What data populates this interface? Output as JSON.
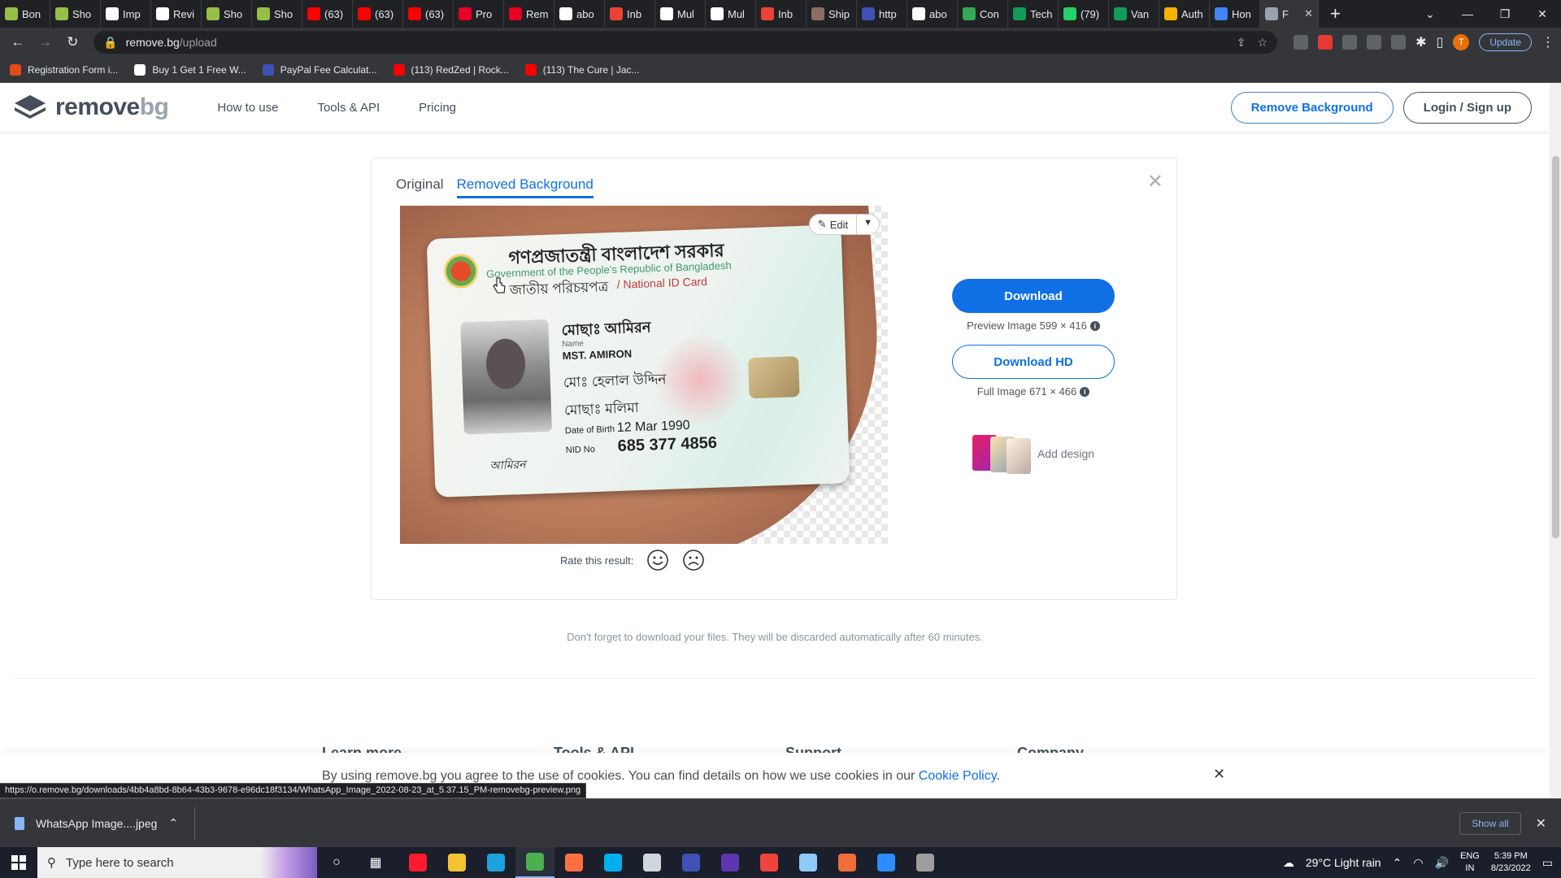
{
  "browser": {
    "tabs": [
      {
        "label": "Bon",
        "color": "#96bf48"
      },
      {
        "label": "Sho",
        "color": "#96bf48"
      },
      {
        "label": "Imp",
        "color": "#ffffff"
      },
      {
        "label": "Revi",
        "color": "#ffffff"
      },
      {
        "label": "Sho",
        "color": "#96bf48"
      },
      {
        "label": "Sho",
        "color": "#96bf48"
      },
      {
        "label": "(63)",
        "color": "#ff0000"
      },
      {
        "label": "(63)",
        "color": "#ff0000"
      },
      {
        "label": "(63)",
        "color": "#ff0000"
      },
      {
        "label": "Pro",
        "color": "#e60023"
      },
      {
        "label": "Rem",
        "color": "#e60023"
      },
      {
        "label": "abo",
        "color": "#ffffff"
      },
      {
        "label": "Inb",
        "color": "#ea4335"
      },
      {
        "label": "Mul",
        "color": "#ffffff"
      },
      {
        "label": "Mul",
        "color": "#ffffff"
      },
      {
        "label": "Inb",
        "color": "#ea4335"
      },
      {
        "label": "Ship",
        "color": "#8d6e63"
      },
      {
        "label": "http",
        "color": "#3f51b5"
      },
      {
        "label": "abo",
        "color": "#ffffff"
      },
      {
        "label": "Con",
        "color": "#34a853"
      },
      {
        "label": "Tech",
        "color": "#0f9d58"
      },
      {
        "label": "(79)",
        "color": "#25d366"
      },
      {
        "label": "Van",
        "color": "#0f9d58"
      },
      {
        "label": "Auth",
        "color": "#f4b400"
      },
      {
        "label": "Hon",
        "color": "#4285f4"
      }
    ],
    "active_tab_label": "F",
    "url_host": "remove.bg",
    "url_path": "/upload",
    "update_label": "Update",
    "profile_initial": "T",
    "bookmarks": [
      {
        "label": "Registration Form i...",
        "color": "#e64a19"
      },
      {
        "label": "Buy 1 Get 1 Free W...",
        "color": "#ffffff"
      },
      {
        "label": "PayPal Fee Calculat...",
        "color": "#3f51b5"
      },
      {
        "label": "(113) RedZed | Rock...",
        "color": "#ff0000"
      },
      {
        "label": "(113) The Cure | Jac...",
        "color": "#ff0000"
      }
    ]
  },
  "site": {
    "logo_main": "remove",
    "logo_accent": "bg",
    "nav": [
      "How to use",
      "Tools & API",
      "Pricing"
    ],
    "header_buttons": {
      "remove_bg": "Remove Background",
      "login": "Login / Sign up"
    },
    "brand_color": "#0f70e6"
  },
  "result": {
    "tabs": [
      "Original",
      "Removed Background"
    ],
    "active_tab": "Removed Background",
    "edit_label": "Edit",
    "rate_label": "Rate this result:",
    "download_label": "Download",
    "preview_note": "Preview Image 599 × 416",
    "download_hd_label": "Download HD",
    "full_note": "Full Image 671 × 466",
    "add_design_label": "Add design"
  },
  "id_card": {
    "title_bn": "গণপ্রজাতন্ত্রী বাংলাদেশ সরকার",
    "gov_en": "Government of the People's Republic of Bangladesh",
    "nid_bn": "জাতীয় পরিচয়পত্র",
    "nid_en": "/ National ID Card",
    "name_bn": "মোছাঃ আমিরন",
    "name_label": "Name",
    "name_en": "MST. AMIRON",
    "father_bn": "মোঃ হেলাল উদ্দিন",
    "mother_bn": "মোছাঃ মলিমা",
    "dob_label": "Date of Birth",
    "dob": "12 Mar 1990",
    "nid_label": "NID No",
    "nid": "685 377 4856",
    "signature": "আমিরন"
  },
  "reminder": "Don't forget to download your files. They will be discarded automatically after 60 minutes.",
  "footer_heads": [
    "Learn more",
    "Tools & API",
    "Support",
    "Company"
  ],
  "cookie": {
    "text": "By using remove.bg you agree to the use of cookies. You can find details on how we use cookies in our ",
    "link": "Cookie Policy",
    "tail": "."
  },
  "status_url": "https://o.remove.bg/downloads/4bb4a8bd-8b64-43b3-9678-e96dc18f3134/WhatsApp_Image_2022-08-23_at_5.37.15_PM-removebg-preview.png",
  "download_shelf": {
    "file_name": "WhatsApp Image....jpeg",
    "show_all": "Show all"
  },
  "taskbar": {
    "search_placeholder": "Type here to search",
    "apps": [
      {
        "name": "opera",
        "color": "#ff1b2d"
      },
      {
        "name": "file-explorer",
        "color": "#f4c430"
      },
      {
        "name": "edge",
        "color": "#1fa0e0"
      },
      {
        "name": "chrome",
        "color": "#4caf50"
      },
      {
        "name": "chrome-2",
        "color": "#ff7043"
      },
      {
        "name": "skype",
        "color": "#00aff0"
      },
      {
        "name": "settings",
        "color": "#cfd8dc"
      },
      {
        "name": "app-blue",
        "color": "#3f51b5"
      },
      {
        "name": "app-purple",
        "color": "#5e35b1"
      },
      {
        "name": "anydesk",
        "color": "#ef443b"
      },
      {
        "name": "app-light",
        "color": "#90caf9"
      },
      {
        "name": "anydesk-2",
        "color": "#ef6c3b"
      },
      {
        "name": "zoom",
        "color": "#2d8cff"
      },
      {
        "name": "app-dark",
        "color": "#9e9e9e"
      }
    ],
    "weather": "29°C  Light rain",
    "lang": "ENG",
    "region": "IN",
    "time": "5:39 PM",
    "date": "8/23/2022"
  }
}
